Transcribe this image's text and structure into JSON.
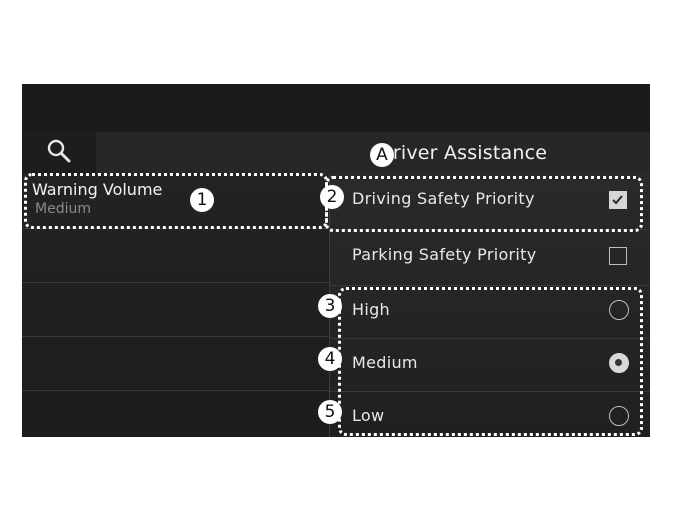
{
  "header": {
    "title": "Driver Assistance",
    "title_marker": "A",
    "search_icon": "search-icon"
  },
  "sidebar": {
    "items": [
      {
        "label": "Warning Volume",
        "value": "Medium",
        "marker": "1"
      }
    ]
  },
  "settings": {
    "driving_safety": {
      "label": "Driving Safety Priority",
      "checked": true,
      "marker": "2"
    },
    "parking_safety": {
      "label": "Parking Safety Priority",
      "checked": false
    },
    "warning_levels": [
      {
        "label": "High",
        "selected": false,
        "marker": "3"
      },
      {
        "label": "Medium",
        "selected": true,
        "marker": "4"
      },
      {
        "label": "Low",
        "selected": false,
        "marker": "5"
      }
    ]
  },
  "colors": {
    "screen_bg": "#1a1a1a",
    "text": "#f2f2f2",
    "subtext": "#8a8a8a",
    "callout": "#ffffff"
  }
}
